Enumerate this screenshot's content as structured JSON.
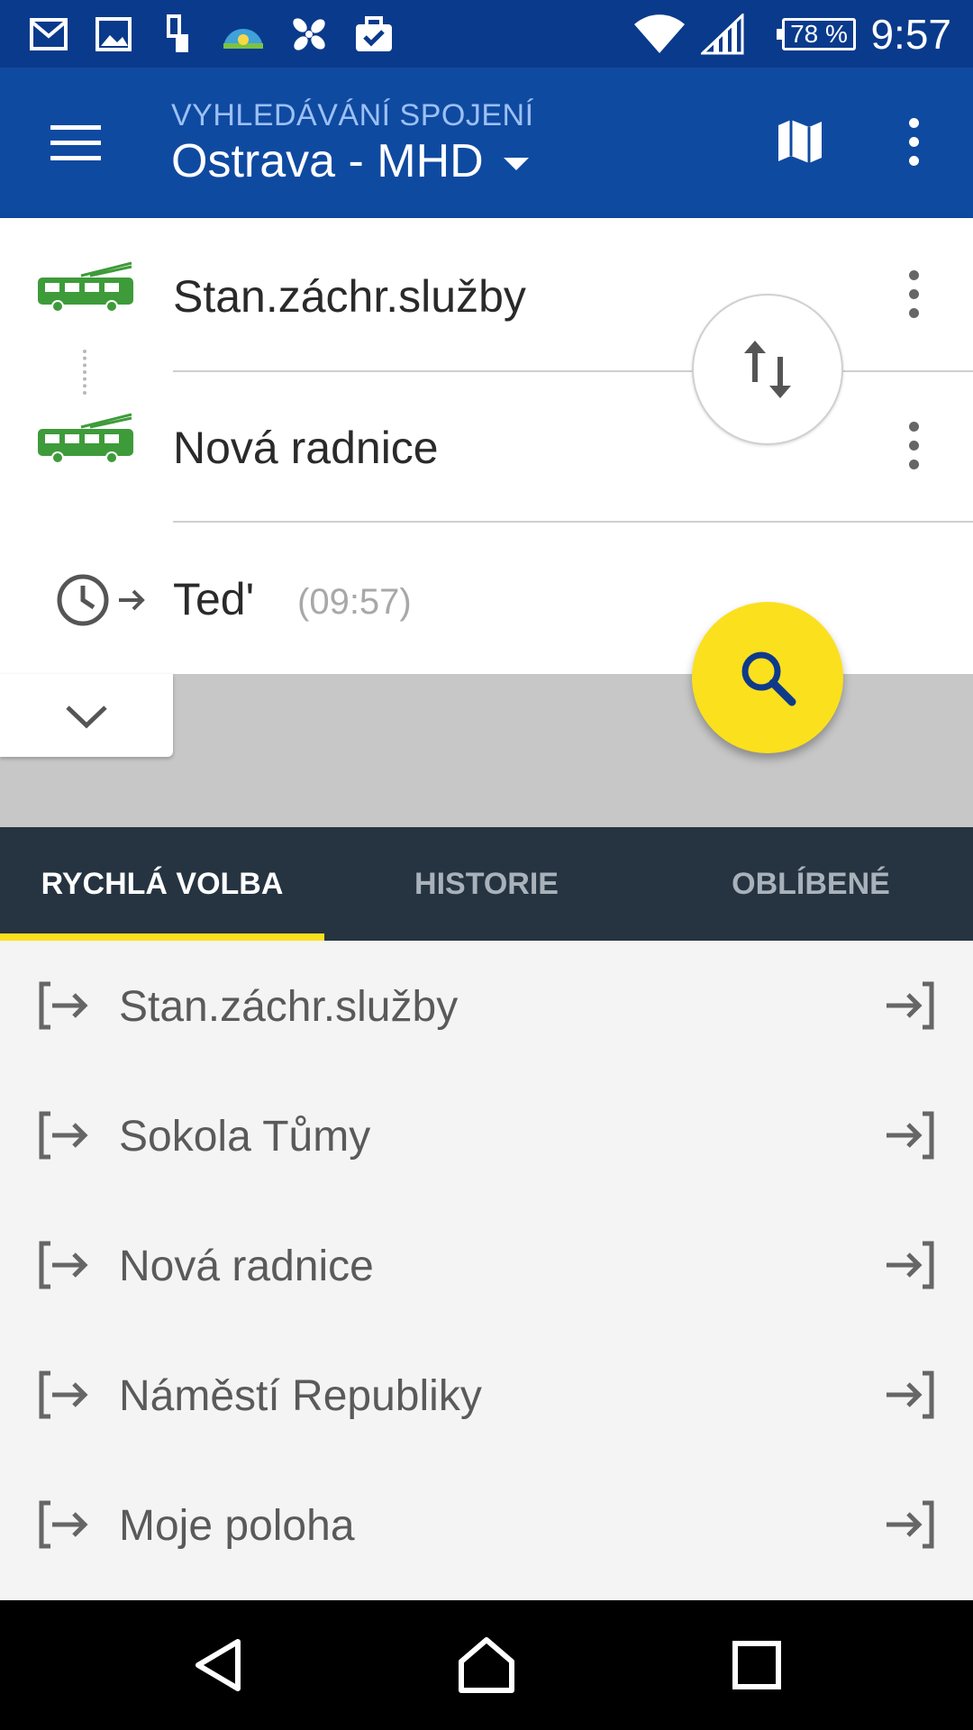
{
  "status_bar": {
    "battery": "78 %",
    "time": "9:57",
    "icons": [
      "gmail-icon",
      "gallery-icon",
      "device-icon",
      "weather-icon",
      "pinwheel-icon",
      "briefcase-check-icon",
      "wifi-icon",
      "signal-icon",
      "battery-icon"
    ]
  },
  "appbar": {
    "subtitle": "VYHLEDÁVÁNÍ SPOJENÍ",
    "title": "Ostrava - MHD"
  },
  "route": {
    "from": "Stan.záchr.služby",
    "to": "Nová radnice",
    "time_label": "Ted'",
    "time_value": "(09:57)",
    "transport_color": "#3e9b3a"
  },
  "tabs": [
    {
      "label": "RYCHLÁ VOLBA",
      "active": true
    },
    {
      "label": "HISTORIE",
      "active": false
    },
    {
      "label": "OBLÍBENÉ",
      "active": false
    }
  ],
  "quick_list": [
    {
      "label": "Stan.záchr.služby"
    },
    {
      "label": "Sokola Tůmy"
    },
    {
      "label": "Nová radnice"
    },
    {
      "label": "Náměstí Republiky"
    },
    {
      "label": "Moje poloha"
    }
  ],
  "colors": {
    "statusbar": "#0a3a8c",
    "appbar": "#0f4aa1",
    "accent": "#fbe01e",
    "tabs_bg": "#263441"
  }
}
